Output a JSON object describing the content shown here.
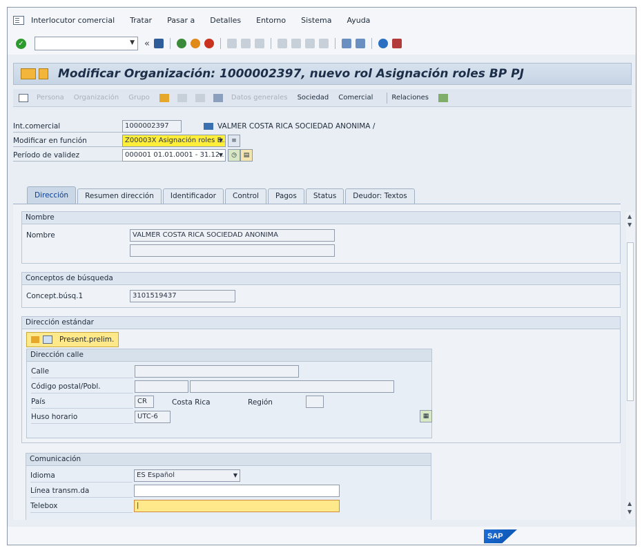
{
  "menu": [
    "Interlocutor comercial",
    "Tratar",
    "Pasar a",
    "Detalles",
    "Entorno",
    "Sistema",
    "Ayuda"
  ],
  "title": "Modificar Organización: 1000002397, nuevo rol Asignación roles BP PJ",
  "app_toolbar": {
    "persona": "Persona",
    "organizacion": "Organización",
    "grupo": "Grupo",
    "datos_generales": "Datos generales",
    "sociedad": "Sociedad",
    "comercial": "Comercial",
    "relaciones": "Relaciones"
  },
  "header": {
    "int_comercial_label": "Int.comercial",
    "int_comercial_value": "1000002397",
    "partner_name": "VALMER COSTA RICA SOCIEDAD ANONIMA /",
    "funcion_label": "Modificar en función",
    "funcion_value": "Z00003X Asignación roles B..",
    "periodo_label": "Período de validez",
    "periodo_value": "000001 01.01.0001 - 31.12.."
  },
  "tabs": [
    "Dirección",
    "Resumen dirección",
    "Identificador",
    "Control",
    "Pagos",
    "Status",
    "Deudor: Textos"
  ],
  "nombre": {
    "group_title": "Nombre",
    "label": "Nombre",
    "value1": "VALMER COSTA RICA SOCIEDAD ANONIMA",
    "value2": ""
  },
  "busqueda": {
    "group_title": "Conceptos de búsqueda",
    "label": "Concept.búsq.1",
    "value": "3101519437"
  },
  "direccion": {
    "group_title": "Dirección estándar",
    "preview_label": "Present.prelim.",
    "calle_group": "Dirección calle",
    "calle_label": "Calle",
    "cp_label": "Código postal/Pobl.",
    "pais_label": "País",
    "pais_code": "CR",
    "pais_name": "Costa Rica",
    "region_label": "Región",
    "huso_label": "Huso horario",
    "huso_value": "UTC-6"
  },
  "comunicacion": {
    "group_title": "Comunicación",
    "idioma_label": "Idioma",
    "idioma_value": "ES Español",
    "linea_label": "Línea transm.da",
    "telebox_label": "Telebox"
  },
  "colors": {
    "highlight_yellow": "#ffee3a",
    "title_blue": "#1d2e48"
  },
  "footer_logo": "SAP"
}
